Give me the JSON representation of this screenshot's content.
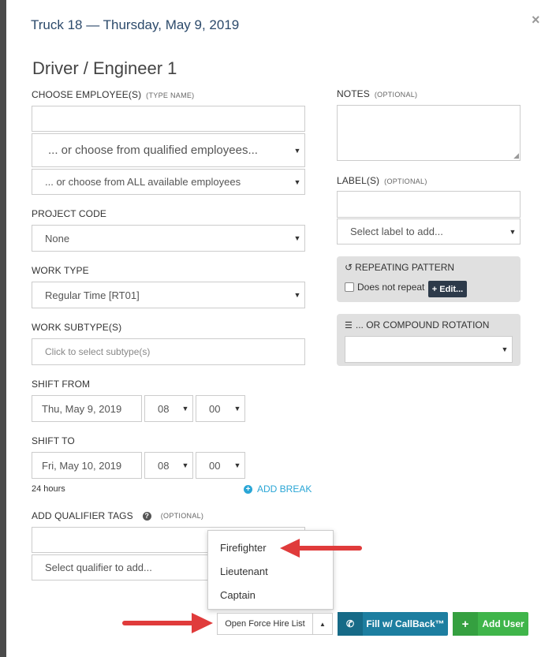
{
  "modal": {
    "title": "Truck 18 — Thursday, May 9, 2019",
    "close_glyph": "×"
  },
  "heading": "Driver / Engineer 1",
  "employees": {
    "label": "Choose Employee(s)",
    "hint": "(Type Name)",
    "qualified_select": "... or choose from qualified employees...",
    "all_select": "... or choose from ALL available employees"
  },
  "project_code": {
    "label": "Project Code",
    "value": "None"
  },
  "work_type": {
    "label": "Work Type",
    "value": "Regular Time [RT01]"
  },
  "work_subtype": {
    "label": "Work Subtype(s)",
    "placeholder": "Click to select subtype(s)"
  },
  "shift_from": {
    "label": "Shift From",
    "date": "Thu, May 9, 2019",
    "hour": "08",
    "minute": "00"
  },
  "shift_to": {
    "label": "Shift To",
    "date": "Fri, May 10, 2019",
    "hour": "08",
    "minute": "00"
  },
  "duration": "24 hours",
  "add_break": "ADD BREAK",
  "qualifier": {
    "label": "Add Qualifier Tags",
    "optional": "(Optional)",
    "select_placeholder": "Select qualifier to add..."
  },
  "notes": {
    "label": "Notes",
    "optional": "(Optional)"
  },
  "labels": {
    "label": "Label(s)",
    "optional": "(Optional)",
    "select_placeholder": "Select label to add..."
  },
  "repeating": {
    "title": "REPEATING PATTERN",
    "checkbox_label": "Does not repeat",
    "edit_button": "+ Edit..."
  },
  "compound": {
    "title": "... OR COMPOUND ROTATION"
  },
  "dropdown_items": [
    "Firefighter",
    "Lieutenant",
    "Captain"
  ],
  "buttons": {
    "force_hire": "Open Force Hire List",
    "fill_callback": "Fill w/ CallBack™",
    "add_user": "Add User"
  },
  "colors": {
    "callback_btn": "#1d7ea0",
    "add_user_btn": "#3fb54a",
    "arrow": "#e03b3b",
    "title": "#2c4a6b",
    "add_break": "#2aa6d6"
  }
}
